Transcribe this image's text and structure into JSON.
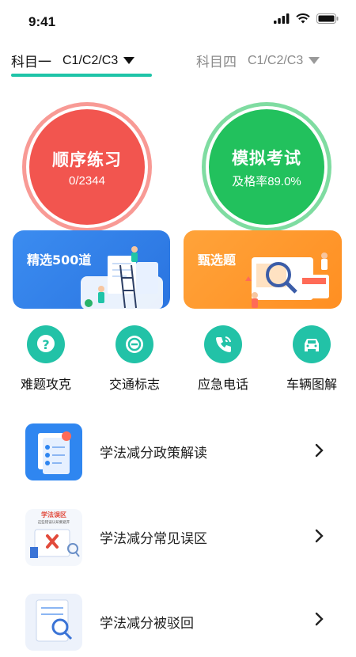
{
  "status": {
    "time": "9:41"
  },
  "tabs": [
    {
      "label": "科目一",
      "sub": "C1/C2/C3"
    },
    {
      "label": "科目四",
      "sub": "C1/C2/C3"
    }
  ],
  "practice": {
    "title": "顺序练习",
    "progress": "0/2344"
  },
  "exam": {
    "title": "模拟考试",
    "pass_rate": "及格率89.0%"
  },
  "banners": {
    "selected": "精选500道",
    "screening": "甄选题"
  },
  "quick": [
    {
      "label": "难题攻克",
      "icon": "question-icon"
    },
    {
      "label": "交通标志",
      "icon": "traffic-sign-icon"
    },
    {
      "label": "应急电话",
      "icon": "phone-icon"
    },
    {
      "label": "车辆图解",
      "icon": "car-icon"
    }
  ],
  "list": [
    {
      "label": "学法减分政策解读",
      "thumb_text": ""
    },
    {
      "label": "学法减分常见误区",
      "thumb_text": "学法误区",
      "thumb_sub": "这些错误认知要避开"
    },
    {
      "label": "学法减分被驳回"
    }
  ],
  "colors": {
    "accent": "#1fc4a8",
    "red": "#f2554f",
    "green": "#22c15d",
    "blue": "#3b8cf0",
    "orange": "#ff9a2e"
  }
}
